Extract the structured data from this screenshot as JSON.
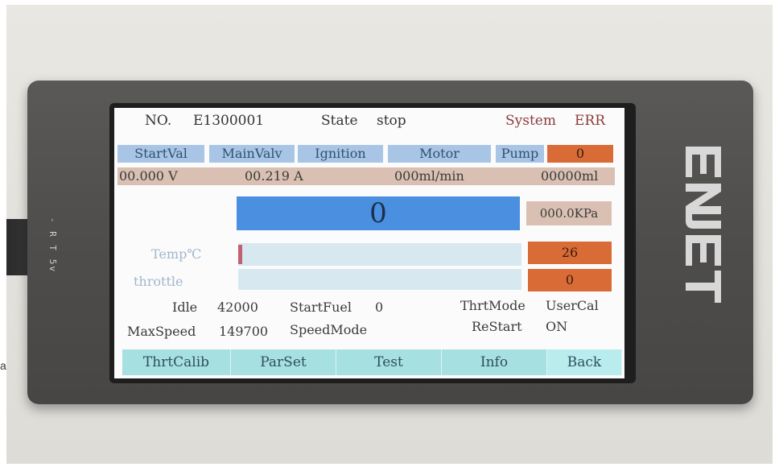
{
  "device": {
    "side_label": "- R T 5v",
    "brand": "ENJET"
  },
  "stray_letter": "a",
  "header": {
    "no_label": "NO.",
    "no_value": "E1300001",
    "state_label": "State",
    "state_value": "stop",
    "system_label": "System",
    "system_value": "ERR"
  },
  "status_buttons": {
    "startval": "StartVal",
    "mainvalv": "MainValv",
    "ignition": "Ignition",
    "motor": "Motor",
    "pump": "Pump",
    "pump_value": "0"
  },
  "readings": {
    "voltage": "00.000 V",
    "current": "00.219 A",
    "flow": "000ml/min",
    "volume": "00000ml"
  },
  "rpm": {
    "value": "0"
  },
  "pressure": {
    "value": "000.0KPa"
  },
  "temp": {
    "label": "Temp℃",
    "value": "26"
  },
  "throttle": {
    "label": "throttle",
    "value": "0"
  },
  "params": {
    "idle_label": "Idle",
    "idle_value": "42000",
    "startfuel_label": "StartFuel",
    "startfuel_value": "0",
    "thrtmode_label": "ThrtMode",
    "thrtmode_value": "UserCal",
    "maxspeed_label": "MaxSpeed",
    "maxspeed_value": "149700",
    "speedmode_label": "SpeedMode",
    "speedmode_value": "",
    "restart_label": "ReStart",
    "restart_value": "ON"
  },
  "tabs": [
    "ThrtCalib",
    "ParSet",
    "Test",
    "Info",
    "Back"
  ],
  "colors": {
    "accent_blue": "#4a8fe0",
    "status_blue": "#a9c5e6",
    "alert_orange": "#d96b36",
    "tab_cyan": "#a6e0e0",
    "gauge_marker": "#c06070"
  }
}
